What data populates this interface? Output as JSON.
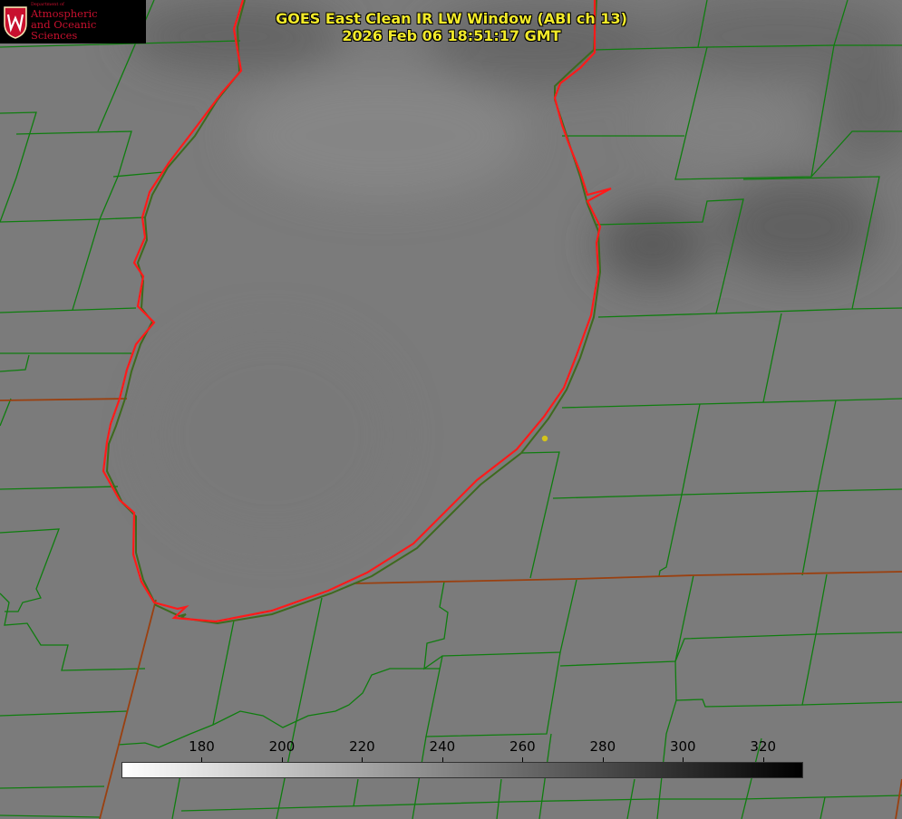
{
  "logo": {
    "department": "Department of",
    "line1": "Atmospheric",
    "line2": "and Oceanic Sciences"
  },
  "title": {
    "line1": "GOES East Clean IR LW Window (ABI ch 13)",
    "line2": "2026 Feb 06 18:51:17 GMT"
  },
  "colorbar": {
    "min": 160,
    "max": 330,
    "ticks": [
      "180",
      "200",
      "220",
      "240",
      "260",
      "280",
      "300",
      "320"
    ],
    "gradient": [
      "#ffffff",
      "#000000"
    ]
  },
  "colors": {
    "shoreline_red": "#ff1a1a",
    "county_lines": "#0f7d0f",
    "state_line": "#9a3a0a",
    "point_marker": "#d4c41a",
    "title_text": "#f2ea2a",
    "logo_red": "#c8102e"
  }
}
